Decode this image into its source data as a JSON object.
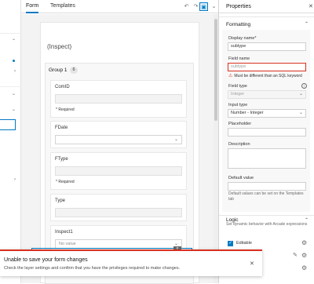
{
  "header": {
    "tabs": [
      {
        "label": "Form",
        "active": true
      },
      {
        "label": "Templates",
        "active": false
      }
    ],
    "toolbar": {
      "undo_icon": "undo-icon",
      "redo_icon": "redo-icon",
      "save_icon": "save-icon",
      "more_icon": "chevron-down-icon"
    }
  },
  "canvas": {
    "form_title": "(Inspect)",
    "group": {
      "label": "Group 1",
      "count": "6"
    },
    "fields": [
      {
        "label": "ComID",
        "required": "* Required",
        "type": "text"
      },
      {
        "label": "FDate",
        "type": "select",
        "value": ""
      },
      {
        "label": "FType",
        "required": "* Required",
        "type": "text"
      },
      {
        "label": "Type",
        "type": "text"
      },
      {
        "label": "Inspect1",
        "type": "select",
        "value": "No value"
      }
    ]
  },
  "properties": {
    "title": "Properties",
    "sections": {
      "formatting": "Formatting",
      "logic": "Logic"
    },
    "display_name": {
      "label": "Display name*",
      "value": "subtype"
    },
    "field_name": {
      "label": "Field name",
      "value": "subtype",
      "error": "Must be different than an SQL keyword"
    },
    "field_type": {
      "label": "Field type",
      "value": "Integer"
    },
    "input_type": {
      "label": "Input type",
      "value": "Number - Integer"
    },
    "placeholder": {
      "label": "Placeholder",
      "value": ""
    },
    "description": {
      "label": "Description",
      "value": ""
    },
    "default_value": {
      "label": "Default value",
      "value": "",
      "hint": "Default values can be set on the Templates tab"
    },
    "logic_desc": "Set dynamic behavior with Arcade expressions",
    "editable": {
      "label": "Editable",
      "checked": true
    }
  },
  "toast": {
    "title": "Unable to save your form changes",
    "message": "Check the layer settings and confirm that you have the privileges required to make changes."
  },
  "colors": {
    "accent": "#007ac2",
    "error": "#d83020"
  }
}
